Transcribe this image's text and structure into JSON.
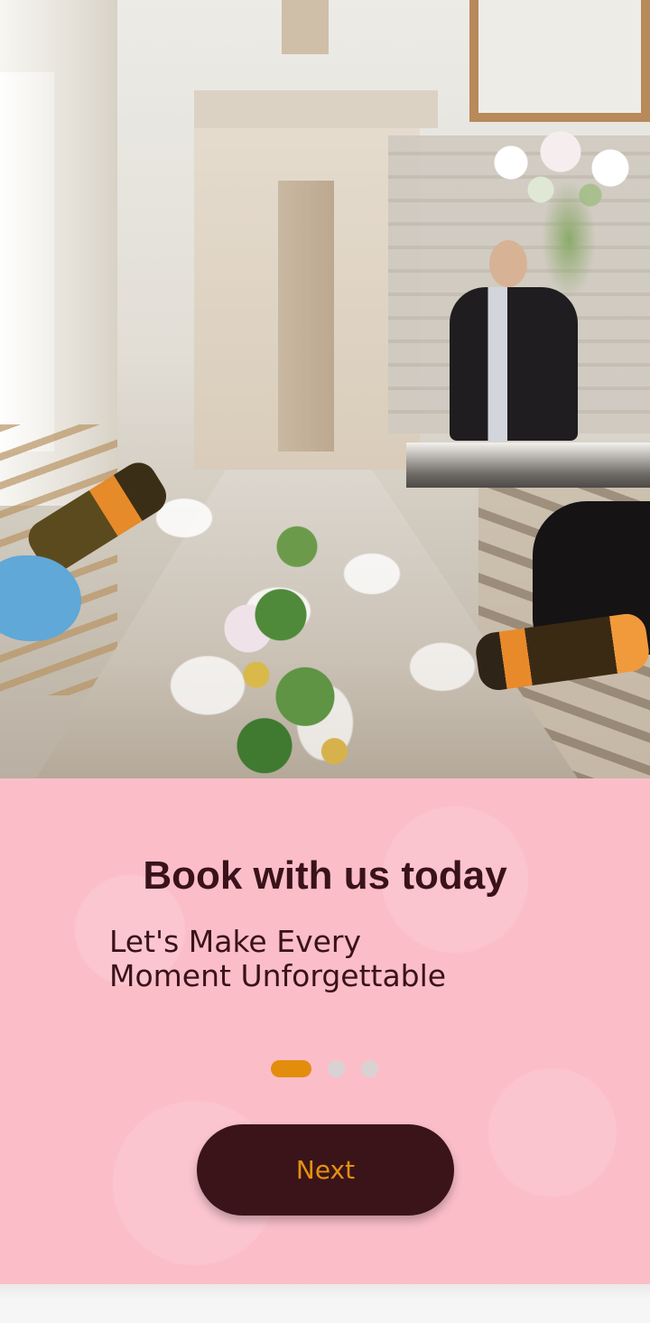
{
  "hero": {
    "image_alt": "Wedding banquet table with champagne being poured"
  },
  "onboarding": {
    "title": "Book with us today",
    "subtitle_line1": "Let's Make Every",
    "subtitle_line2": "Moment Unforgettable",
    "page_index": 0,
    "page_count": 3,
    "next_label": "Next"
  },
  "colors": {
    "card_background": "#fbbec9",
    "title_text": "#3a1219",
    "active_dot": "#e38d0c",
    "inactive_dot": "#d9d2d3",
    "button_background": "#3b141a",
    "button_text": "#e3920f"
  }
}
